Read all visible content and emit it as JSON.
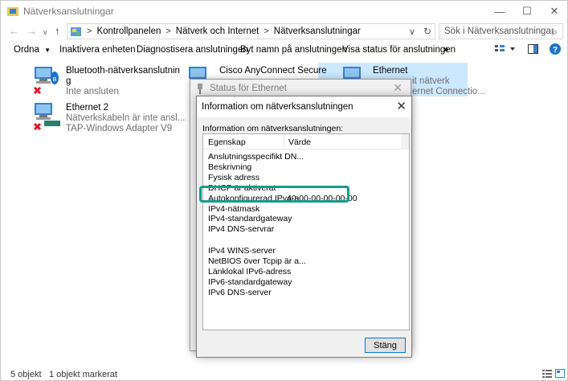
{
  "window": {
    "title": "Nätverksanslutningar",
    "min": "—",
    "max": "☐",
    "close": "✕"
  },
  "nav": {
    "back": "←",
    "forward": "→",
    "up": "↑",
    "dropdown": "∨",
    "refresh": "↻",
    "search_icon": "⌕"
  },
  "address": {
    "crumbs": [
      "Kontrollpanelen",
      "Nätverk och Internet",
      "Nätverksanslutningar"
    ],
    "separator": ">",
    "search_placeholder": "Sök i Nätverksanslutningar"
  },
  "toolbar": {
    "organize": "Ordna",
    "disable": "Inaktivera enheten",
    "diagnose": "Diagnostisera anslutningen",
    "rename": "Byt namn på anslutningen",
    "status": "Visa status för anslutningen",
    "more": "»"
  },
  "connections": [
    {
      "name": "Bluetooth-nätverksanslutnin",
      "name2": "g",
      "status": "Inte ansluten"
    },
    {
      "name": "Ethernet 2",
      "status": "Nätverkskabeln är inte ansl...",
      "adapter": "TAP-Windows Adapter V9"
    },
    {
      "name": "Cisco AnyConnect Secure",
      "status": ""
    },
    {
      "name": "Ethernet",
      "status": "it nätverk",
      "adapter": "ernet Connectio..."
    }
  ],
  "status_dialog": {
    "title": "Status för Ethernet"
  },
  "info_dialog": {
    "title": "Information om nätverksanslutningen",
    "label": "Information om nätverksanslutningen:",
    "col_property": "Egenskap",
    "col_value": "Värde",
    "rows": [
      {
        "property": "Anslutningsspecifikt DN...",
        "value": ""
      },
      {
        "property": "Beskrivning",
        "value": ""
      },
      {
        "property": "Fysisk adress",
        "value": ""
      },
      {
        "property": "DHCP är aktiverat",
        "value": ""
      },
      {
        "property": "Autokonfigurerad IPv4-a...",
        "value": "a0-00-00-00-00-00"
      },
      {
        "property": "IPv4-nätmask",
        "value": ""
      },
      {
        "property": "IPv4-standardgateway",
        "value": ""
      },
      {
        "property": "IPv4 DNS-servrar",
        "value": ""
      },
      {
        "property": "",
        "value": ""
      },
      {
        "property": "IPv4 WINS-server",
        "value": ""
      },
      {
        "property": "NetBIOS över Tcpip är a...",
        "value": ""
      },
      {
        "property": "Länklokal IPv6-adress",
        "value": ""
      },
      {
        "property": "IPv6-standardgateway",
        "value": ""
      },
      {
        "property": "IPv6 DNS-server",
        "value": ""
      }
    ],
    "close_button": "Stäng",
    "close_x": "✕"
  },
  "statusbar": {
    "count": "5 objekt",
    "selected": "1 objekt markerat"
  },
  "colors": {
    "highlight": "#1a9a8a",
    "selection": "#cce8ff",
    "disconnected": "#e81123"
  }
}
